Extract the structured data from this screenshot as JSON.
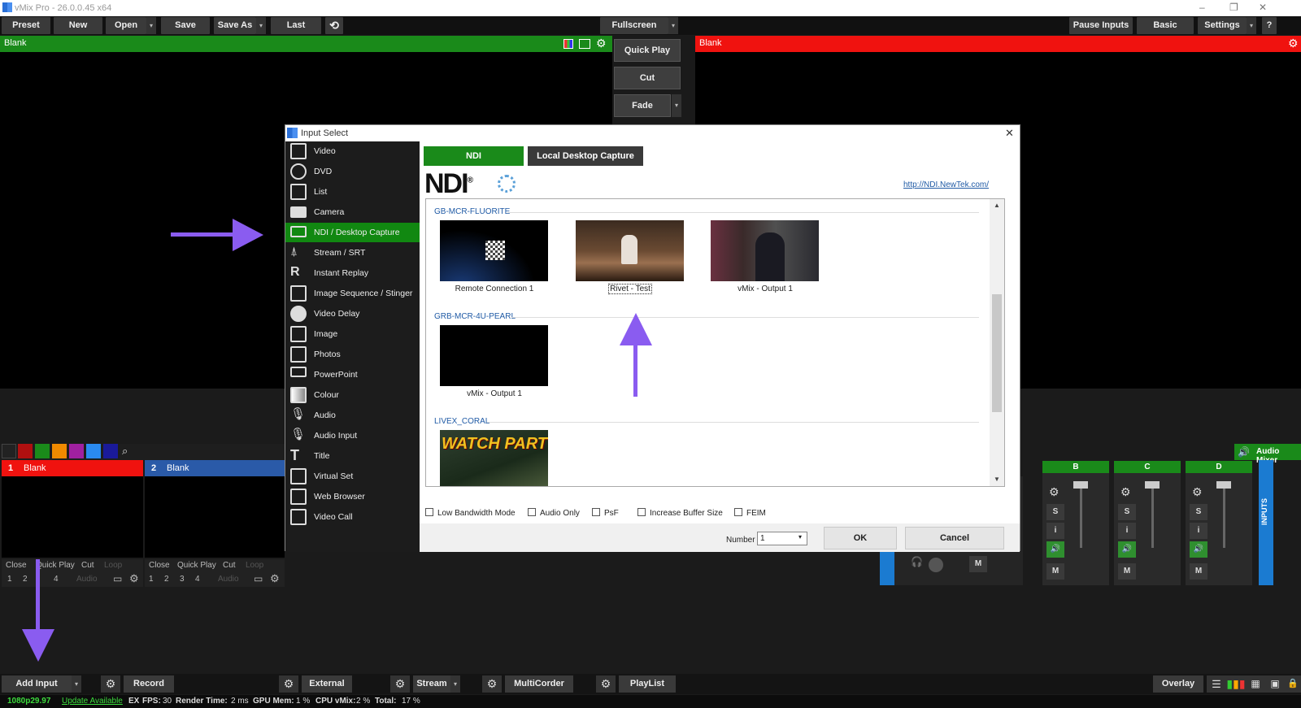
{
  "window": {
    "title": "vMix Pro - 26.0.0.45 x64",
    "min": "–",
    "max": "❐",
    "close": "✕"
  },
  "toolbar": {
    "preset": "Preset",
    "new": "New",
    "open": "Open",
    "save": "Save",
    "save_as": "Save As",
    "last": "Last",
    "refresh_icon": "⟲",
    "fullscreen": "Fullscreen",
    "pause_inputs": "Pause Inputs",
    "basic": "Basic",
    "settings": "Settings",
    "help": "?"
  },
  "preview": {
    "label": "Blank"
  },
  "output": {
    "label": "Blank"
  },
  "transitions": {
    "quick_play": "Quick Play",
    "cut": "Cut",
    "fade": "Fade"
  },
  "dialog": {
    "title": "Input Select",
    "close": "✕",
    "categories": [
      {
        "label": "Video",
        "selected": false
      },
      {
        "label": "DVD",
        "selected": false
      },
      {
        "label": "List",
        "selected": false
      },
      {
        "label": "Camera",
        "selected": false
      },
      {
        "label": "NDI / Desktop Capture",
        "selected": true
      },
      {
        "label": "Stream / SRT",
        "selected": false
      },
      {
        "label": "Instant Replay",
        "selected": false
      },
      {
        "label": "Image Sequence / Stinger",
        "selected": false
      },
      {
        "label": "Video Delay",
        "selected": false
      },
      {
        "label": "Image",
        "selected": false
      },
      {
        "label": "Photos",
        "selected": false
      },
      {
        "label": "PowerPoint",
        "selected": false
      },
      {
        "label": "Colour",
        "selected": false
      },
      {
        "label": "Audio",
        "selected": false
      },
      {
        "label": "Audio Input",
        "selected": false
      },
      {
        "label": "Title",
        "selected": false
      },
      {
        "label": "Virtual Set",
        "selected": false
      },
      {
        "label": "Web Browser",
        "selected": false
      },
      {
        "label": "Video Call",
        "selected": false
      }
    ],
    "tabs": {
      "ndi": "NDI",
      "desktop": "Local Desktop Capture"
    },
    "ndi_logo": "NDI",
    "ndi_reg": "®",
    "ndi_link": "http://NDI.NewTek.com/",
    "groups": [
      {
        "name": "GB-MCR-FLUORITE",
        "sources": [
          "Remote Connection 1",
          "Rivet - Test",
          "vMix - Output 1"
        ]
      },
      {
        "name": "GRB-MCR-4U-PEARL",
        "sources": [
          "vMix - Output 1"
        ]
      },
      {
        "name": "LIVEX_CORAL",
        "sources": [
          "WATCH PARTY"
        ]
      }
    ],
    "options": [
      "Low Bandwidth Mode",
      "Audio Only",
      "PsF",
      "Increase Buffer Size",
      "FEIM"
    ],
    "number_label": "Number",
    "number_value": "1",
    "ok": "OK",
    "cancel": "Cancel"
  },
  "inputs": [
    {
      "num": "1",
      "label": "Blank",
      "color": "#f0120f"
    },
    {
      "num": "2",
      "label": "Blank",
      "color": "#2a5aa8"
    }
  ],
  "input_controls": {
    "close": "Close",
    "quick_play": "Quick Play",
    "cut": "Cut",
    "loop": "Loop",
    "n1": "1",
    "n2": "2",
    "n3": "3",
    "n4": "4",
    "audio": "Audio"
  },
  "color_swatches": [
    "#b01010",
    "#1a8a1a",
    "#f08a00",
    "#a020a0",
    "#2a8af0",
    "#1a1a9a"
  ],
  "audio_mixer": {
    "title": "Audio Mixer",
    "buses": [
      "B",
      "C",
      "D"
    ],
    "s": "S",
    "i": "i",
    "m": "M",
    "inputs_label": "INPUTS"
  },
  "bottom": {
    "add_input": "Add Input",
    "record": "Record",
    "external": "External",
    "stream": "Stream",
    "multicorder": "MultiCorder",
    "playlist": "PlayList",
    "overlay": "Overlay"
  },
  "status": {
    "format": "1080p29.97",
    "update": "Update Available",
    "ex": "EX",
    "fps_label": "FPS:",
    "fps": "30",
    "render_label": "Render Time:",
    "render": "2 ms",
    "gpu_label": "GPU Mem:",
    "gpu": "1 %",
    "cpu_label": "CPU vMix:",
    "cpu": "2 %",
    "total_label": "Total:",
    "total": "17 %"
  }
}
